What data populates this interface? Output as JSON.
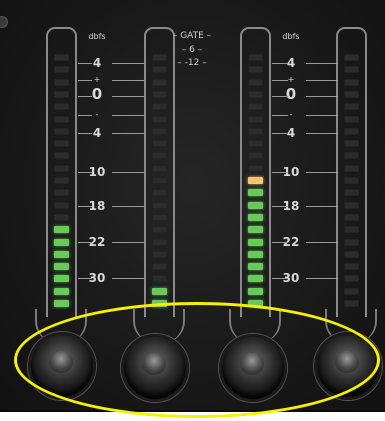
{
  "meter_scale_left": {
    "unit": "dbfs",
    "marks": [
      "4",
      "+",
      "0",
      "-",
      "4",
      "10",
      "18",
      "22",
      "30"
    ]
  },
  "meter_scale_right": {
    "unit": "dbfs",
    "marks": [
      "4",
      "+",
      "0",
      "-",
      "4",
      "10",
      "18",
      "22",
      "30"
    ]
  },
  "gate": {
    "title": "GATE",
    "values": [
      "6",
      "-12"
    ]
  },
  "meters": [
    {
      "name": "channel-1",
      "lit_segments": 7,
      "peak_color": "#69c95a"
    },
    {
      "name": "channel-2",
      "lit_segments": 2,
      "peak_color": "#69c95a"
    },
    {
      "name": "channel-3",
      "lit_segments": 11,
      "peak_color": "#f0c874"
    },
    {
      "name": "channel-4",
      "lit_segments": 0,
      "peak_color": "#69c95a"
    }
  ],
  "knobs": [
    "knob-1",
    "knob-2",
    "knob-3",
    "knob-4"
  ],
  "colors": {
    "panel": "#1a1a1a",
    "segment_green": "#69c95a",
    "segment_amber": "#f0c874",
    "annotation_highlight": "#f7f000"
  }
}
